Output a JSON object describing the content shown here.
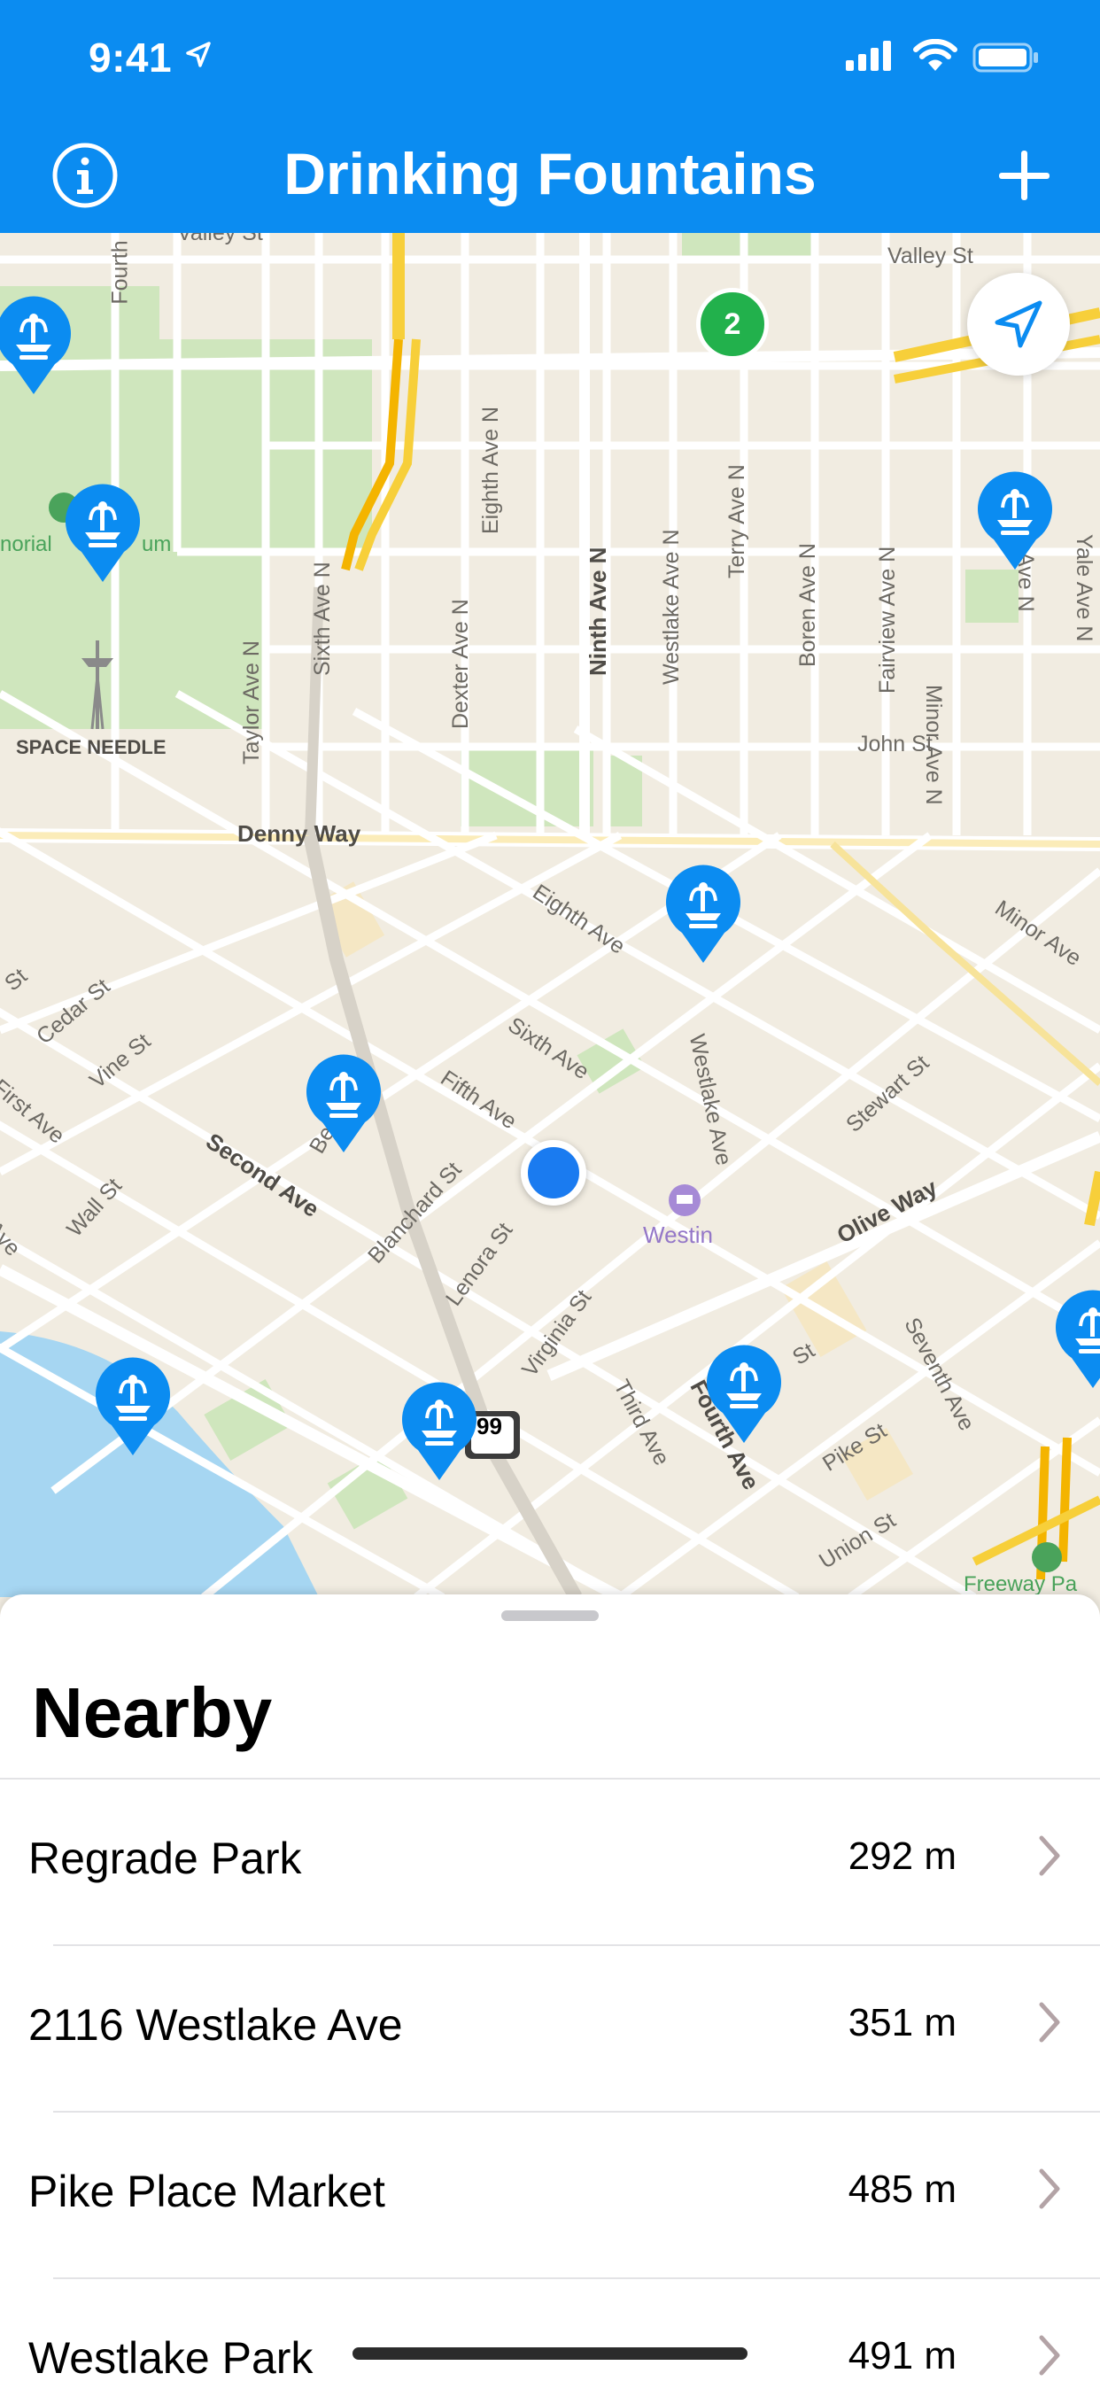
{
  "status_bar": {
    "time": "9:41"
  },
  "header": {
    "title": "Drinking Fountains",
    "info_icon": "info-circle-icon",
    "add_icon": "plus-icon"
  },
  "map": {
    "locate_icon": "location-arrow-icon",
    "cluster_count": "2",
    "street_labels": {
      "valley_st_left": "Valley St",
      "valley_st_right": "Valley St",
      "fourth": "Fourth",
      "eighth_ave_n": "Eighth Ave N",
      "ninth_ave_n": "Ninth Ave N",
      "westlake_ave_n": "Westlake Ave N",
      "terry_ave_n": "Terry Ave N",
      "boren_ave_n": "Boren Ave N",
      "fairview_ave_n": "Fairview Ave N",
      "minor_ave_n": "Minor Ave N",
      "ave_n": "Ave N",
      "yale_ave_n": "Yale Ave N",
      "taylor_ave_n": "Taylor Ave N",
      "sixth_ave_n": "Sixth Ave N",
      "dexter_ave_n": "Dexter Ave N",
      "john_st": "John St",
      "denny_way": "Denny Way",
      "eighth_ave": "Eighth Ave",
      "minor_ave": "Minor Ave",
      "cedar_st": "Cedar St",
      "st": "St",
      "first_ave": "First Ave",
      "vine_st": "Vine St",
      "sixth_ave": "Sixth Ave",
      "westlake_ave": "Westlake Ave",
      "stewart_st": "Stewart St",
      "fifth_ave": "Fifth Ave",
      "second_ave": "Second Ave",
      "bell": "Bel",
      "blanchard_st": "Blanchard St",
      "wall_st": "Wall St",
      "ave": "Ave",
      "lenora_st": "Lenora St",
      "olive_way": "Olive Way",
      "virginia_st": "Virginia St",
      "seventh_ave": "Seventh Ave",
      "third_ave": "Third Ave",
      "fourth_ave": "Fourth Ave",
      "pike_st": "Pike St",
      "st2": "St",
      "union_st": "Union St",
      "highway_99": "99"
    },
    "poi": {
      "westin": "Westin",
      "space_needle": "SPACE NEEDLE",
      "memorial": "norial",
      "stadium": "um",
      "freeway_park": "Freeway Pa"
    }
  },
  "sheet": {
    "title": "Nearby",
    "items": [
      {
        "name": "Regrade Park",
        "distance": "292 m"
      },
      {
        "name": "2116 Westlake Ave",
        "distance": "351 m"
      },
      {
        "name": "Pike Place Market",
        "distance": "485 m"
      },
      {
        "name": "Westlake Park",
        "distance": "491 m"
      }
    ]
  },
  "colors": {
    "header": "#0b8cf1",
    "pin": "#0b8cf1",
    "cluster": "#22b14c",
    "user_location": "#1a7bf0",
    "map_bg": "#f1ece1",
    "park": "#cfe6bd",
    "water": "#a6d6f2",
    "highway": "#f7cf3a"
  }
}
